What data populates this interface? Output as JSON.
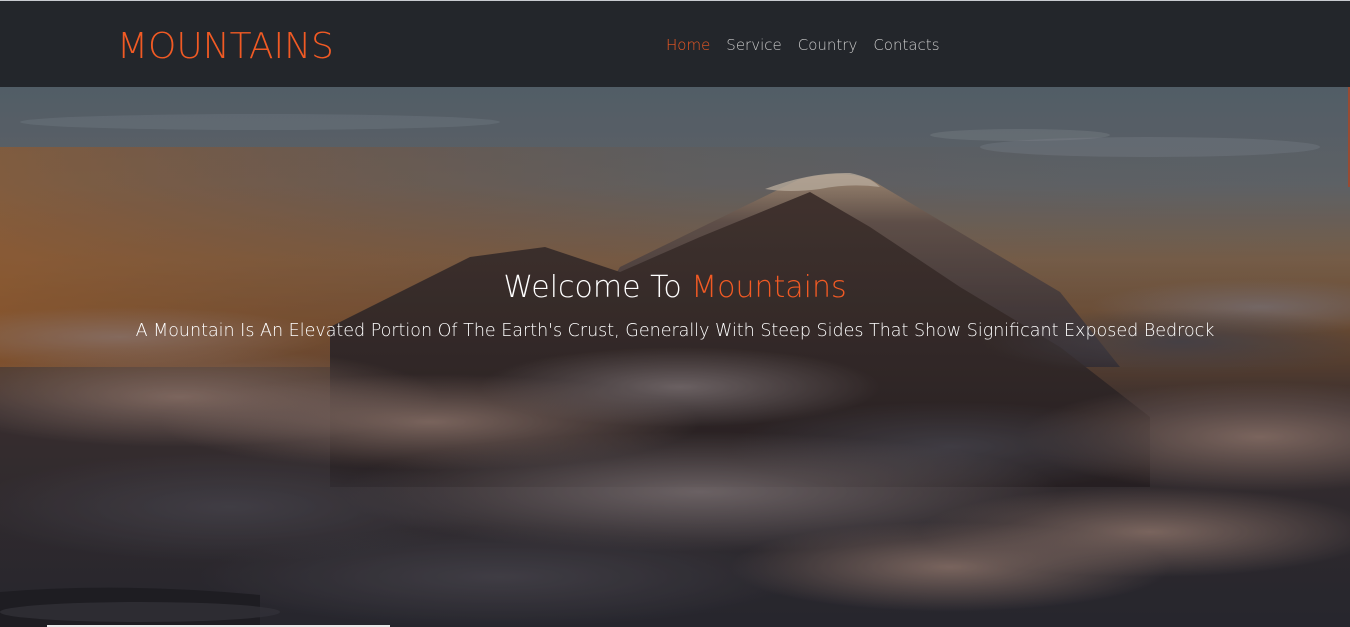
{
  "brand": {
    "name": "MOUNTAINS"
  },
  "nav": {
    "items": [
      {
        "label": "Home",
        "active": true
      },
      {
        "label": "Service",
        "active": false
      },
      {
        "label": "Country",
        "active": false
      },
      {
        "label": "Contacts",
        "active": false
      }
    ]
  },
  "hero": {
    "title_prefix": "Welcome To ",
    "title_accent": "Mountains",
    "subtitle": "A Mountain Is An Elevated Portion Of The Earth's Crust, Generally With Steep Sides That Show Significant Exposed Bedrock"
  },
  "colors": {
    "accent": "#f15a24",
    "header_bg": "#23262b",
    "nav_text": "#c9c9c9"
  }
}
